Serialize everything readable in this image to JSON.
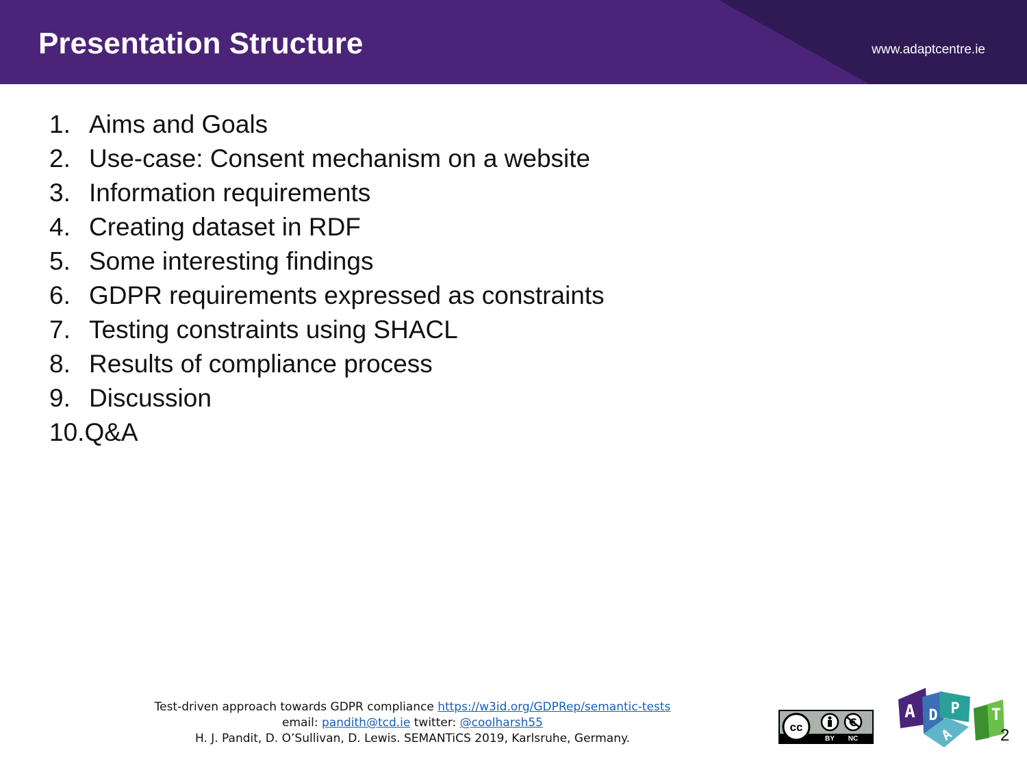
{
  "header": {
    "title": "Presentation Structure",
    "url": "www.adaptcentre.ie"
  },
  "agenda": {
    "items": [
      {
        "num": "1.",
        "label": "Aims and Goals"
      },
      {
        "num": "2.",
        "label": "Use-case: Consent mechanism on a website"
      },
      {
        "num": "3.",
        "label": "Information requirements"
      },
      {
        "num": "4.",
        "label": "Creating dataset in RDF"
      },
      {
        "num": "5.",
        "label": "Some interesting findings"
      },
      {
        "num": "6.",
        "label": "GDPR requirements expressed as constraints"
      },
      {
        "num": "7.",
        "label": "Testing constraints using SHACL"
      },
      {
        "num": "8.",
        "label": "Results of compliance process"
      },
      {
        "num": "9.",
        "label": "Discussion"
      },
      {
        "num": "10.",
        "label": "Q&A"
      }
    ]
  },
  "footer": {
    "line1_text": "Test-driven approach towards GDPR compliance ",
    "line1_link": "https://w3id.org/GDPRep/semantic-tests",
    "email_label": "email: ",
    "email_link": "pandith@tcd.ie",
    "twitter_label": " twitter: ",
    "twitter_link": "@coolharsh55",
    "line3": "H. J. Pandit, D. O’Sullivan, D. Lewis. SEMANTiCS 2019, Karlsruhe, Germany."
  },
  "license": {
    "cc": "cc",
    "by": "BY",
    "nc": "NC"
  },
  "logo": {
    "letters": [
      "A",
      "D",
      "P",
      "A",
      "T"
    ],
    "colors": [
      "#4b2479",
      "#3b6fb6",
      "#2aa198",
      "#5fb6c8",
      "#6cc04a"
    ]
  },
  "page_number": "2"
}
